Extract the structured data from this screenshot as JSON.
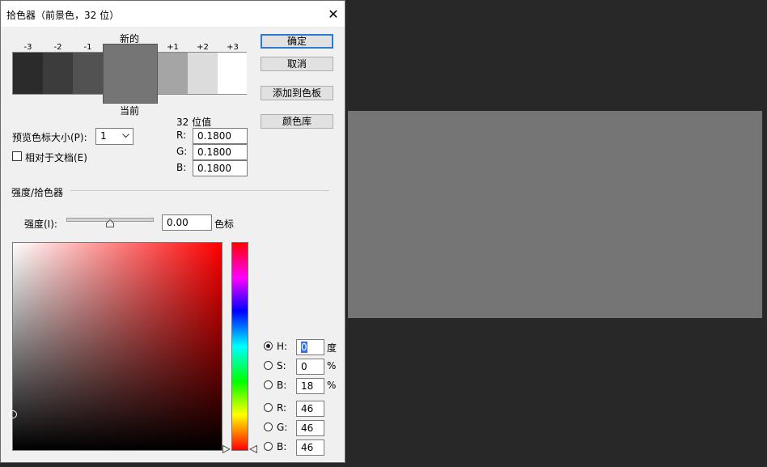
{
  "dialog": {
    "title": "拾色器（前景色，32 位）",
    "close_glyph": "✕"
  },
  "buttons": {
    "ok": "确定",
    "cancel": "取消",
    "add_to_swatches": "添加到色板",
    "color_libraries": "颜色库"
  },
  "swatches": {
    "new_label": "新的",
    "current_label": "当前",
    "stops": [
      {
        "label": "-3",
        "color": "#2b2b2b"
      },
      {
        "label": "-2",
        "color": "#3c3c3c"
      },
      {
        "label": "-1",
        "color": "#525252"
      },
      {
        "label": "+1",
        "color": "#a5a5a5"
      },
      {
        "label": "+2",
        "color": "#dcdcdc"
      },
      {
        "label": "+3",
        "color": "#ffffff"
      }
    ],
    "new_color": "#757575"
  },
  "preview_size": {
    "label": "预览色标大小(P):",
    "value": "1"
  },
  "relative_to_doc": {
    "label": "相对于文档(E)",
    "checked": false
  },
  "bit32": {
    "heading": "32 位值",
    "r_label": "R:",
    "r_value": "0.1800",
    "g_label": "G:",
    "g_value": "0.1800",
    "b_label": "B:",
    "b_value": "0.1800"
  },
  "intensity": {
    "section_title": "强度/拾色器",
    "label": "强度(I):",
    "value": "0.00",
    "stops_label": "色标",
    "slider_fraction": 0.5
  },
  "hsb_rgb": {
    "h_label": "H:",
    "h_value": "0",
    "h_unit": "度",
    "s_label": "S:",
    "s_value": "0",
    "s_unit": "%",
    "b_label": "B:",
    "b_value": "18",
    "b_unit": "%",
    "r_label": "R:",
    "r_value": "46",
    "g_label": "G:",
    "g_value": "46",
    "bb_label": "B:",
    "bb_value": "46",
    "selected": "H"
  },
  "preview": {
    "color": "#757575"
  }
}
